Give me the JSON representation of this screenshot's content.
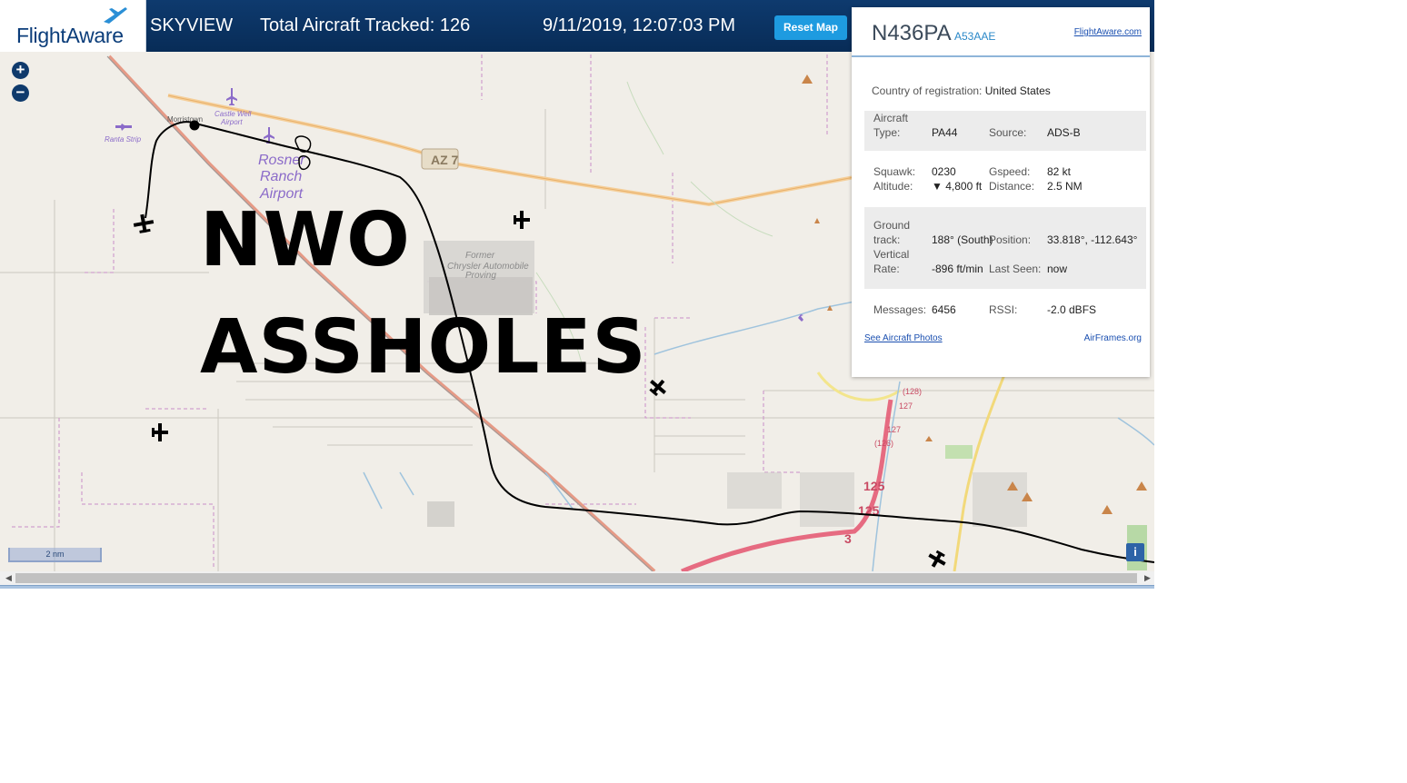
{
  "header": {
    "logo": "FlightAware",
    "app_name": "SKYVIEW",
    "total_aircraft": "Total Aircraft Tracked: 126",
    "datetime": "9/11/2019, 12:07:03 PM",
    "reset_label": "Reset Map"
  },
  "map": {
    "zoom_in": "+",
    "zoom_out": "−",
    "overlay_line1": "NWO",
    "overlay_line2": "ASSHOLES",
    "scale_label": "2 nm",
    "info_label": "i",
    "labels": {
      "castle_well": "Castle Well",
      "airport": "Airport",
      "ranta_strip": "Ranta Strip",
      "morristown": "Morristown",
      "rosner": "Rosner",
      "ranch": "Ranch",
      "airport2": "Airport",
      "former": "Former",
      "proving": "Chrysler Automobile",
      "proving2": "Proving",
      "az_shield": "AZ 7",
      "r125": "125",
      "r125b": "125",
      "r3": "3",
      "r128": "(128)",
      "r127": "127",
      "r126": "(126)"
    }
  },
  "panel": {
    "callsign": "N436PA",
    "hex": "A53AAE",
    "fa_link": "FlightAware.com",
    "country_label": "Country of registration:",
    "country_value": "United States",
    "aircraft_type_label_1": "Aircraft",
    "aircraft_type_label_2": "Type:",
    "aircraft_type": "PA44",
    "source_label": "Source:",
    "source": "ADS-B",
    "squawk_label": "Squawk:",
    "squawk": "0230",
    "gspeed_label": "Gspeed:",
    "gspeed": "82 kt",
    "altitude_label": "Altitude:",
    "altitude": "▼ 4,800 ft",
    "distance_label": "Distance:",
    "distance": "2.5 NM",
    "ground_label_1": "Ground",
    "ground_label_2": "track:",
    "ground_track": "188° (South)",
    "position_label": "Position:",
    "position": "33.818°, -112.643°",
    "vrate_label_1": "Vertical",
    "vrate_label_2": "Rate:",
    "vertical_rate": "-896 ft/min",
    "lastseen_label": "Last Seen:",
    "last_seen": "now",
    "messages_label": "Messages:",
    "messages": "6456",
    "rssi_label": "RSSI:",
    "rssi": "-2.0 dBFS",
    "photos_link": "See Aircraft Photos",
    "airframes_link": "AirFrames.org"
  },
  "colors": {
    "header_bg": "#0b3363",
    "accent": "#1e9be0",
    "map_bg": "#f1eee8",
    "track": "#000000"
  }
}
